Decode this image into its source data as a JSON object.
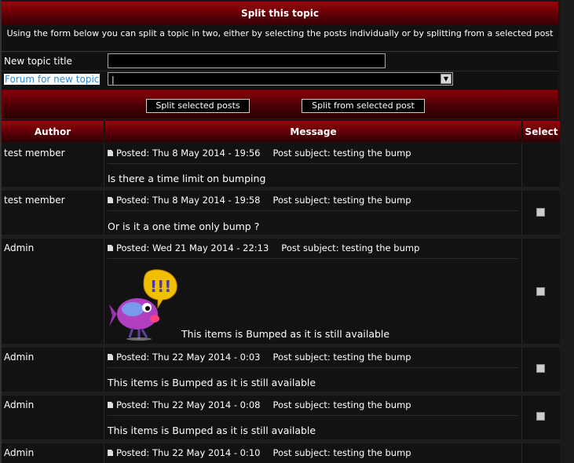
{
  "header": {
    "title": "Split this topic",
    "description": "Using the form below you can split a topic in two, either by selecting the posts individually or by splitting from a selected post"
  },
  "form": {
    "new_topic_label": "New topic title",
    "new_topic_value": "",
    "forum_label": "Forum for new topic",
    "forum_value": "|"
  },
  "buttons": {
    "split_selected": "Split selected posts",
    "split_from": "Split from selected post"
  },
  "table": {
    "col_author": "Author",
    "col_message": "Message",
    "col_select": "Select"
  },
  "posts": [
    {
      "author": "test member",
      "posted": "Posted: Thu 8 May 2014 - 19:56",
      "subject": "Post subject: testing the bump",
      "body": "Is there a time limit on bumping",
      "has_checkbox": false
    },
    {
      "author": "test member",
      "posted": "Posted: Thu 8 May 2014 - 19:58",
      "subject": "Post subject: testing the bump",
      "body": "Or is it a one time only bump ?",
      "has_checkbox": true
    },
    {
      "author": "Admin",
      "posted": "Posted: Wed 21 May 2014 - 22:13",
      "subject": "Post subject: testing the bump",
      "body": "This items is Bumped as it is still available",
      "has_checkbox": true
    },
    {
      "author": "Admin",
      "posted": "Posted: Thu 22 May 2014 - 0:03",
      "subject": "Post subject: testing the bump",
      "body": "This items is Bumped as it is still available",
      "has_checkbox": true
    },
    {
      "author": "Admin",
      "posted": "Posted: Thu 22 May 2014 - 0:08",
      "subject": "Post subject: testing the bump",
      "body": "This items is Bumped as it is still available",
      "has_checkbox": true
    },
    {
      "author": "Admin",
      "posted": "Posted: Thu 22 May 2014 - 0:10",
      "subject": "Post subject: testing the bump",
      "body": "",
      "has_checkbox": false
    }
  ],
  "icons": {
    "post": "post-icon",
    "emoji": "fish-exclamation-emoji",
    "dropdown": "chevron-down-icon"
  },
  "colors": {
    "accent": "#8a0008",
    "link": "#2a8ad6"
  }
}
